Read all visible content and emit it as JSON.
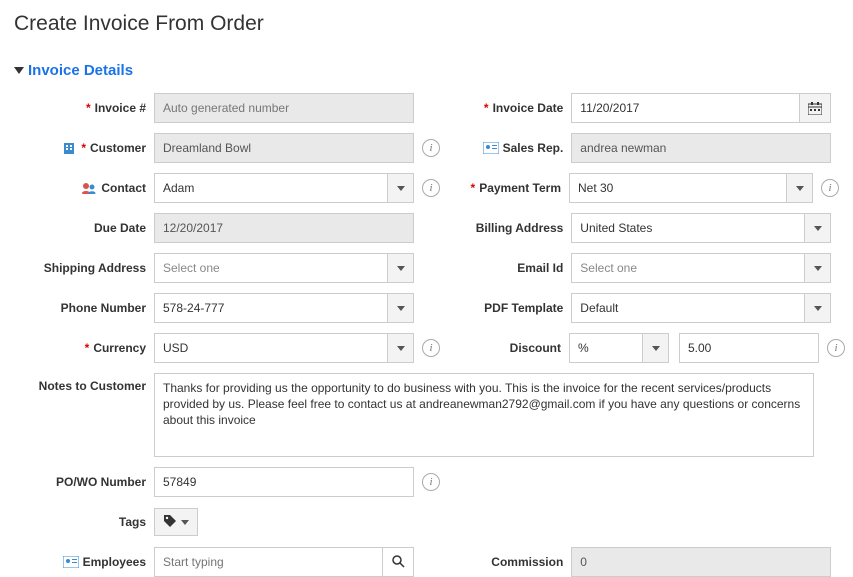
{
  "page": {
    "title": "Create Invoice From Order"
  },
  "section": {
    "title": "Invoice Details"
  },
  "labels": {
    "invoice_no": "Invoice #",
    "invoice_date": "Invoice Date",
    "customer": "Customer",
    "sales_rep": "Sales Rep.",
    "contact": "Contact",
    "payment_term": "Payment Term",
    "due_date": "Due Date",
    "billing_address": "Billing Address",
    "shipping_address": "Shipping Address",
    "email_id": "Email Id",
    "phone_number": "Phone Number",
    "pdf_template": "PDF Template",
    "currency": "Currency",
    "discount": "Discount",
    "notes": "Notes to Customer",
    "po_wo": "PO/WO Number",
    "tags": "Tags",
    "employees": "Employees",
    "commission": "Commission"
  },
  "values": {
    "invoice_no_placeholder": "Auto generated number",
    "invoice_date": "11/20/2017",
    "customer": "Dreamland Bowl",
    "sales_rep": "andrea newman",
    "contact": "Adam",
    "payment_term": "Net 30",
    "due_date": "12/20/2017",
    "billing_address": "United States",
    "shipping_address_placeholder": "Select one",
    "email_id_placeholder": "Select one",
    "phone_number": "578-24-777",
    "pdf_template": "Default",
    "currency": "USD",
    "discount_type": "%",
    "discount_value": "5.00",
    "notes": "Thanks for providing us the opportunity to do business with you. This is the invoice for the recent services/products provided by us. Please feel free to contact us at andreanewman2792@gmail.com if you have any questions or concerns about this invoice",
    "po_wo": "57849",
    "employees_placeholder": "Start typing",
    "commission": "0"
  }
}
